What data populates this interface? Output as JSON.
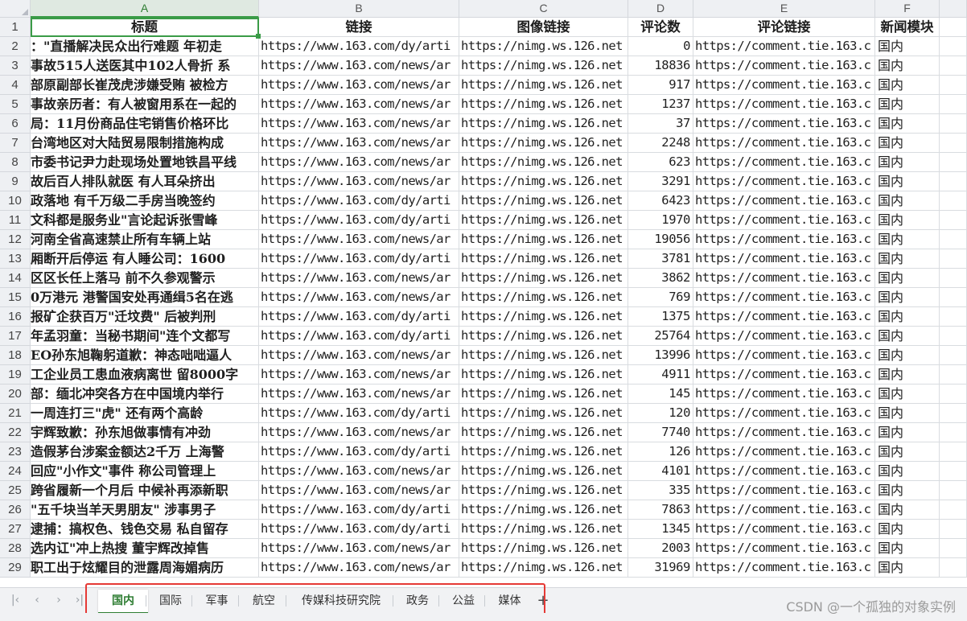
{
  "columns": [
    "A",
    "B",
    "C",
    "D",
    "E",
    "F"
  ],
  "headers": [
    "标题",
    "链接",
    "图像链接",
    "评论数",
    "评论链接",
    "新闻模块"
  ],
  "rows": [
    {
      "n": "2",
      "title": "：\"直播解决民众出行难题 年初走",
      "link": "https://www.163.com/dy/arti",
      "img": "https://nimg.ws.126.net",
      "comments": "0",
      "clink": "https://comment.tie.163.c",
      "module": "国内"
    },
    {
      "n": "3",
      "title": "事故515人送医其中102人骨折 系",
      "link": "https://www.163.com/news/ar",
      "img": "https://nimg.ws.126.net",
      "comments": "18836",
      "clink": "https://comment.tie.163.c",
      "module": "国内"
    },
    {
      "n": "4",
      "title": "部原副部长崔茂虎涉嫌受贿 被检方",
      "link": "https://www.163.com/news/ar",
      "img": "https://nimg.ws.126.net",
      "comments": "917",
      "clink": "https://comment.tie.163.c",
      "module": "国内"
    },
    {
      "n": "5",
      "title": "事故亲历者：有人被窗用系在一起的",
      "link": "https://www.163.com/news/ar",
      "img": "https://nimg.ws.126.net",
      "comments": "1237",
      "clink": "https://comment.tie.163.c",
      "module": "国内"
    },
    {
      "n": "6",
      "title": "局：11月份商品住宅销售价格环比",
      "link": "https://www.163.com/news/ar",
      "img": "https://nimg.ws.126.net",
      "comments": "37",
      "clink": "https://comment.tie.163.c",
      "module": "国内"
    },
    {
      "n": "7",
      "title": "台湾地区对大陆贸易限制措施构成",
      "link": "https://www.163.com/news/ar",
      "img": "https://nimg.ws.126.net",
      "comments": "2248",
      "clink": "https://comment.tie.163.c",
      "module": "国内"
    },
    {
      "n": "8",
      "title": "市委书记尹力赴现场处置地铁昌平线",
      "link": "https://www.163.com/news/ar",
      "img": "https://nimg.ws.126.net",
      "comments": "623",
      "clink": "https://comment.tie.163.c",
      "module": "国内"
    },
    {
      "n": "9",
      "title": "故后百人排队就医 有人耳朵挤出",
      "link": "https://www.163.com/news/ar",
      "img": "https://nimg.ws.126.net",
      "comments": "3291",
      "clink": "https://comment.tie.163.c",
      "module": "国内"
    },
    {
      "n": "10",
      "title": "政落地 有千万级二手房当晚签约",
      "link": "https://www.163.com/dy/arti",
      "img": "https://nimg.ws.126.net",
      "comments": "6423",
      "clink": "https://comment.tie.163.c",
      "module": "国内"
    },
    {
      "n": "11",
      "title": "文科都是服务业\"言论起诉张雪峰",
      "link": "https://www.163.com/dy/arti",
      "img": "https://nimg.ws.126.net",
      "comments": "1970",
      "clink": "https://comment.tie.163.c",
      "module": "国内"
    },
    {
      "n": "12",
      "title": " 河南全省高速禁止所有车辆上站",
      "link": "https://www.163.com/news/ar",
      "img": "https://nimg.ws.126.net",
      "comments": "19056",
      "clink": "https://comment.tie.163.c",
      "module": "国内"
    },
    {
      "n": "13",
      "title": "厢断开后停运 有人睡公司：1600",
      "link": "https://www.163.com/dy/arti",
      "img": "https://nimg.ws.126.net",
      "comments": "3781",
      "clink": "https://comment.tie.163.c",
      "module": "国内"
    },
    {
      "n": "14",
      "title": "区区长任上落马 前不久参观警示",
      "link": "https://www.163.com/news/ar",
      "img": "https://nimg.ws.126.net",
      "comments": "3862",
      "clink": "https://comment.tie.163.c",
      "module": "国内"
    },
    {
      "n": "15",
      "title": "0万港元 港警国安处再通缉5名在逃",
      "link": "https://www.163.com/news/ar",
      "img": "https://nimg.ws.126.net",
      "comments": "769",
      "clink": "https://comment.tie.163.c",
      "module": "国内"
    },
    {
      "n": "16",
      "title": "报矿企获百万\"迁坟费\" 后被判刑",
      "link": "https://www.163.com/dy/arti",
      "img": "https://nimg.ws.126.net",
      "comments": "1375",
      "clink": "https://comment.tie.163.c",
      "module": "国内"
    },
    {
      "n": "17",
      "title": "年孟羽童：当秘书期间\"连个文都写",
      "link": "https://www.163.com/dy/arti",
      "img": "https://nimg.ws.126.net",
      "comments": "25764",
      "clink": "https://comment.tie.163.c",
      "module": "国内"
    },
    {
      "n": "18",
      "title": "EO孙东旭鞠躬道歉：神态咄咄逼人",
      "link": "https://www.163.com/news/ar",
      "img": "https://nimg.ws.126.net",
      "comments": "13996",
      "clink": "https://comment.tie.163.c",
      "module": "国内"
    },
    {
      "n": "19",
      "title": "工企业员工患血液病离世 留8000字",
      "link": "https://www.163.com/news/ar",
      "img": "https://nimg.ws.126.net",
      "comments": "4911",
      "clink": "https://comment.tie.163.c",
      "module": "国内"
    },
    {
      "n": "20",
      "title": "部：缅北冲突各方在中国境内举行",
      "link": "https://www.163.com/news/ar",
      "img": "https://nimg.ws.126.net",
      "comments": "145",
      "clink": "https://comment.tie.163.c",
      "module": "国内"
    },
    {
      "n": "21",
      "title": "一周连打三\"虎\" 还有两个高龄",
      "link": "https://www.163.com/dy/arti",
      "img": "https://nimg.ws.126.net",
      "comments": "120",
      "clink": "https://comment.tie.163.c",
      "module": "国内"
    },
    {
      "n": "22",
      "title": "宇辉致歉：孙东旭做事情有冲劲",
      "link": "https://www.163.com/news/ar",
      "img": "https://nimg.ws.126.net",
      "comments": "7740",
      "clink": "https://comment.tie.163.c",
      "module": "国内"
    },
    {
      "n": "23",
      "title": "造假茅台涉案金额达2千万 上海警",
      "link": "https://www.163.com/dy/arti",
      "img": "https://nimg.ws.126.net",
      "comments": "126",
      "clink": "https://comment.tie.163.c",
      "module": "国内"
    },
    {
      "n": "24",
      "title": "回应\"小作文\"事件 称公司管理上",
      "link": "https://www.163.com/news/ar",
      "img": "https://nimg.ws.126.net",
      "comments": "4101",
      "clink": "https://comment.tie.163.c",
      "module": "国内"
    },
    {
      "n": "25",
      "title": "跨省履新一个月后 中候补再添新职",
      "link": "https://www.163.com/news/ar",
      "img": "https://nimg.ws.126.net",
      "comments": "335",
      "clink": "https://comment.tie.163.c",
      "module": "国内"
    },
    {
      "n": "26",
      "title": "\"五千块当羊天男朋友\" 涉事男子",
      "link": "https://www.163.com/dy/arti",
      "img": "https://nimg.ws.126.net",
      "comments": "7863",
      "clink": "https://comment.tie.163.c",
      "module": "国内"
    },
    {
      "n": "27",
      "title": "逮捕：搞权色、钱色交易 私自留存",
      "link": "https://www.163.com/dy/arti",
      "img": "https://nimg.ws.126.net",
      "comments": "1345",
      "clink": "https://comment.tie.163.c",
      "module": "国内"
    },
    {
      "n": "28",
      "title": "选内讧\"冲上热搜 董宇辉改掉售",
      "link": "https://www.163.com/news/ar",
      "img": "https://nimg.ws.126.net",
      "comments": "2003",
      "clink": "https://comment.tie.163.c",
      "module": "国内"
    },
    {
      "n": "29",
      "title": "职工出于炫耀目的泄露周海媚病历",
      "link": "https://www.163.com/news/ar",
      "img": "https://nimg.ws.126.net",
      "comments": "31969",
      "clink": "https://comment.tie.163.c",
      "module": "国内"
    }
  ],
  "header_row_number": "1",
  "tabs": [
    "国内",
    "国际",
    "军事",
    "航空",
    "传媒科技研究院",
    "政务",
    "公益",
    "媒体"
  ],
  "active_tab": "国内",
  "nav": {
    "first": "|‹",
    "prev": "‹",
    "next": "›",
    "last": "›|",
    "add": "+"
  },
  "watermark": "CSDN @一个孤独的对象实例",
  "colors": {
    "accent": "#2e7d32",
    "selection": "#3a9b47",
    "highlight_box": "#e53935"
  }
}
